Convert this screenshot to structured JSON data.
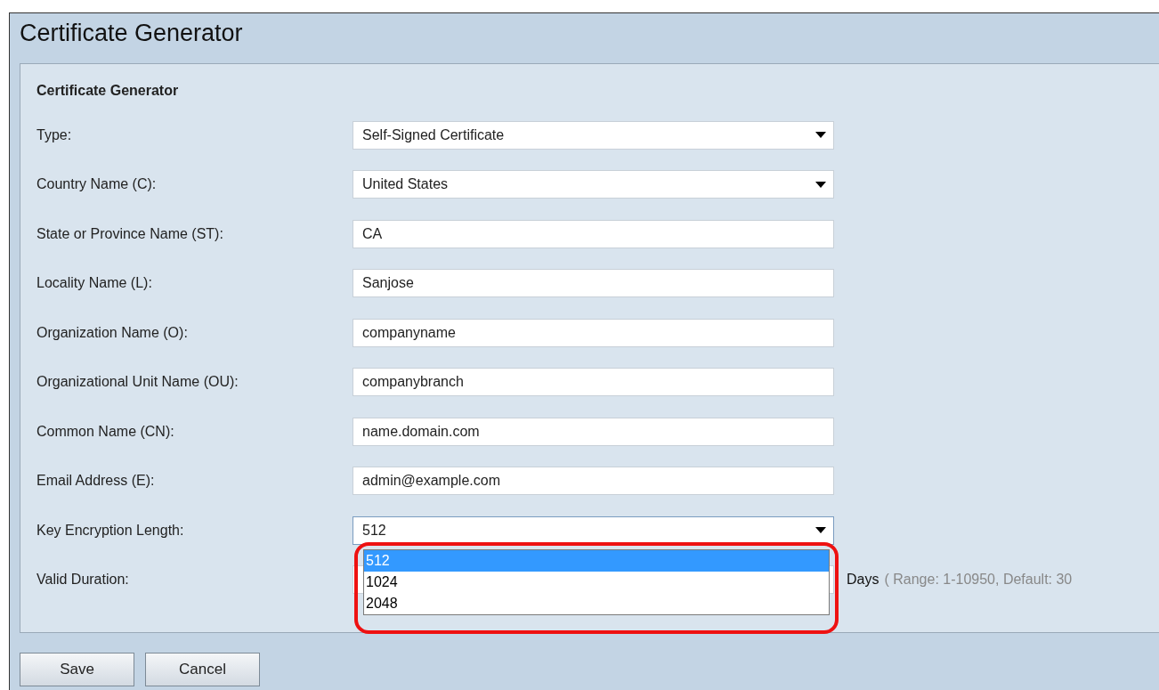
{
  "window": {
    "title": "Certificate Generator"
  },
  "section": {
    "title": "Certificate Generator"
  },
  "fields": [
    {
      "label": "Type:",
      "kind": "select",
      "value": "Self-Signed Certificate"
    },
    {
      "label": "Country Name (C):",
      "kind": "select",
      "value": "United States"
    },
    {
      "label": "State or Province Name (ST):",
      "kind": "text",
      "value": "CA"
    },
    {
      "label": "Locality Name (L):",
      "kind": "text",
      "value": "Sanjose"
    },
    {
      "label": "Organization Name (O):",
      "kind": "text",
      "value": "companyname"
    },
    {
      "label": "Organizational Unit Name (OU):",
      "kind": "text",
      "value": "companybranch"
    },
    {
      "label": "Common Name (CN):",
      "kind": "text",
      "value": "name.domain.com"
    },
    {
      "label": "Email Address (E):",
      "kind": "text",
      "value": "admin@example.com"
    },
    {
      "label": "Key Encryption Length:",
      "kind": "select",
      "value": "512",
      "expanded": true,
      "highlighted": true,
      "options": [
        {
          "label": "512",
          "selected": true
        },
        {
          "label": "1024",
          "selected": false
        },
        {
          "label": "2048",
          "selected": false
        }
      ]
    },
    {
      "label": "Valid Duration:",
      "kind": "duration",
      "unit": "Days",
      "hint": "( Range: 1-10950, Default: 30"
    }
  ],
  "buttons": [
    "Save",
    "Cancel"
  ]
}
